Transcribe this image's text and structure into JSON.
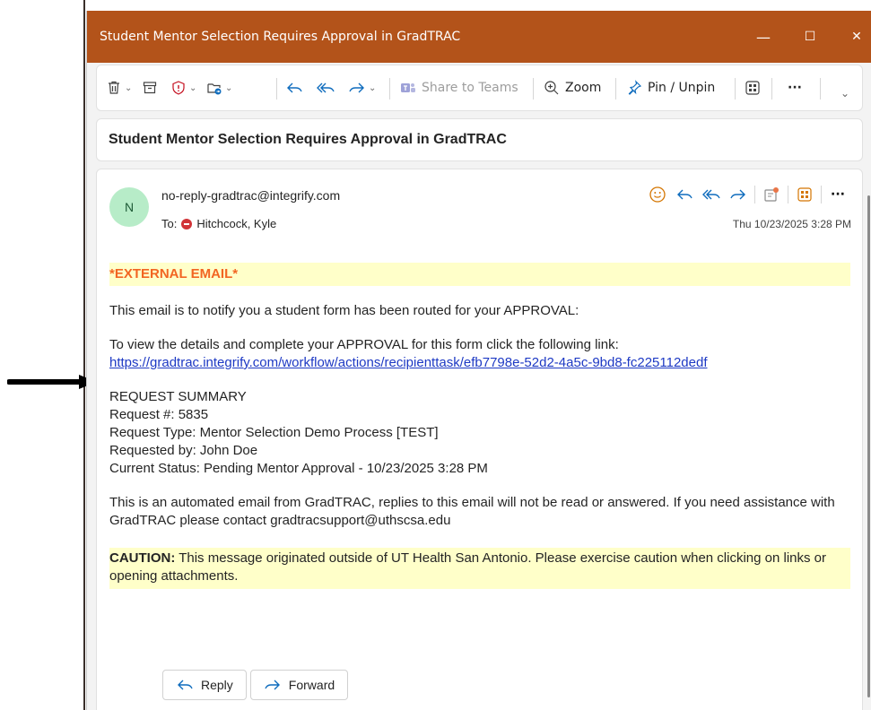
{
  "window": {
    "title": "Student Mentor Selection Requires Approval in GradTRAC",
    "controls": {
      "minimize": "—",
      "maximize": "☐",
      "close": "✕"
    }
  },
  "toolbar": {
    "share_to_teams": "Share to Teams",
    "zoom": "Zoom",
    "pin": "Pin / Unpin",
    "more": "···"
  },
  "message": {
    "subject": "Student Mentor Selection Requires Approval in GradTRAC",
    "avatar_initial": "N",
    "sender": "no-reply-gradtrac@integrify.com",
    "to_label": "To:",
    "recipient": "Hitchcock, Kyle",
    "timestamp": "Thu 10/23/2025 3:28 PM",
    "more": "···"
  },
  "body": {
    "external_banner": "*EXTERNAL EMAIL*",
    "intro": "This email is to notify you a student form has been routed for your APPROVAL:",
    "view_details": "To view the details and complete your APPROVAL for this form click the following link:",
    "link": "https://gradtrac.integrify.com/workflow/actions/recipienttask/efb7798e-52d2-4a5c-9bd8-fc225112dedf",
    "summary_heading": "REQUEST SUMMARY",
    "request_number": "Request #: 5835",
    "request_type": "Request Type: Mentor Selection Demo Process [TEST]",
    "requested_by": "Requested by: John Doe",
    "current_status": "Current Status: Pending Mentor Approval - 10/23/2025 3:28 PM",
    "automated_note": "This is an automated email from GradTRAC, replies to this email will not be read or answered. If you need assistance with GradTRAC please contact gradtracsupport@uthscsa.edu",
    "caution_label": "CAUTION:",
    "caution_text": " This message originated outside of UT Health San Antonio. Please exercise caution when clicking on links or opening attachments."
  },
  "actions": {
    "reply": "Reply",
    "forward": "Forward"
  },
  "colors": {
    "titlebar": "#b3531a",
    "external_text": "#f26522",
    "banner_bg": "#ffffc9",
    "link": "#1d39c4"
  }
}
